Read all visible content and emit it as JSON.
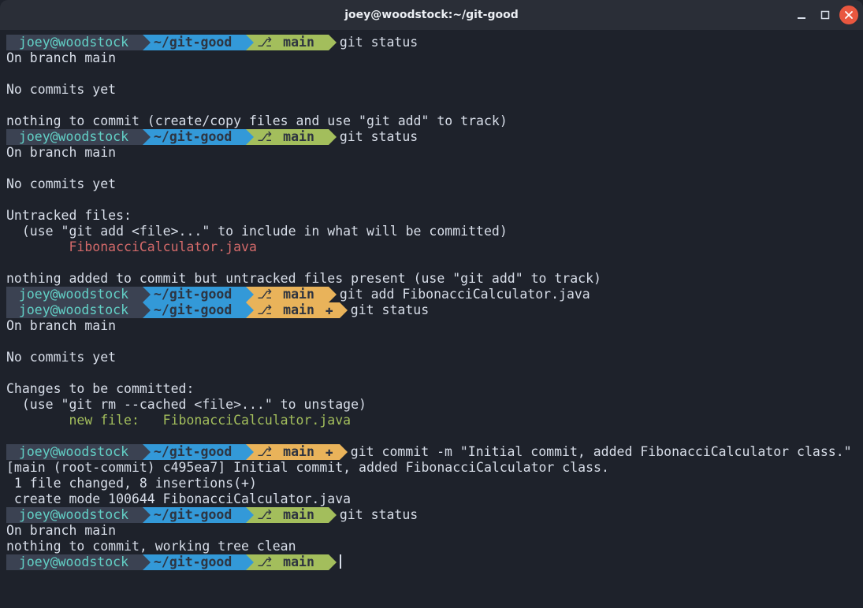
{
  "window": {
    "title": "joey@woodstock:~/git-good"
  },
  "prompt": {
    "userhost": "joey@woodstock",
    "path": "~/git-good",
    "branch": "main",
    "branch_glyph": "⎇",
    "plus_glyph": "✚"
  },
  "blocks": [
    {
      "branch_color": "green",
      "dirty": false,
      "cmd": "git status",
      "output": [
        {
          "t": "On branch main"
        },
        {
          "t": ""
        },
        {
          "t": "No commits yet"
        },
        {
          "t": ""
        },
        {
          "t": "nothing to commit (create/copy files and use \"git add\" to track)"
        }
      ]
    },
    {
      "branch_color": "green",
      "dirty": false,
      "cmd": "git status",
      "output": [
        {
          "t": "On branch main"
        },
        {
          "t": ""
        },
        {
          "t": "No commits yet"
        },
        {
          "t": ""
        },
        {
          "t": "Untracked files:"
        },
        {
          "t": "  (use \"git add <file>...\" to include in what will be committed)"
        },
        {
          "t": "        FibonacciCalculator.java",
          "cls": "red"
        },
        {
          "t": ""
        },
        {
          "t": "nothing added to commit but untracked files present (use \"git add\" to track)"
        }
      ]
    },
    {
      "branch_color": "yellow",
      "dirty": false,
      "cmd": "git add FibonacciCalculator.java",
      "output": []
    },
    {
      "branch_color": "yellow",
      "dirty": true,
      "cmd": "git status",
      "output": [
        {
          "t": "On branch main"
        },
        {
          "t": ""
        },
        {
          "t": "No commits yet"
        },
        {
          "t": ""
        },
        {
          "t": "Changes to be committed:"
        },
        {
          "t": "  (use \"git rm --cached <file>...\" to unstage)"
        },
        {
          "t": "        new file:   FibonacciCalculator.java",
          "cls": "grn"
        },
        {
          "t": ""
        }
      ]
    },
    {
      "branch_color": "yellow",
      "dirty": true,
      "cmd": "git commit -m \"Initial commit, added FibonacciCalculator class.\"",
      "output": [
        {
          "t": "[main (root-commit) c495ea7] Initial commit, added FibonacciCalculator class."
        },
        {
          "t": " 1 file changed, 8 insertions(+)"
        },
        {
          "t": " create mode 100644 FibonacciCalculator.java"
        }
      ]
    },
    {
      "branch_color": "green",
      "dirty": false,
      "cmd": "git status",
      "output": [
        {
          "t": "On branch main"
        },
        {
          "t": "nothing to commit, working tree clean"
        }
      ]
    },
    {
      "branch_color": "green",
      "dirty": false,
      "cmd": null,
      "cursor": true,
      "output": []
    }
  ]
}
